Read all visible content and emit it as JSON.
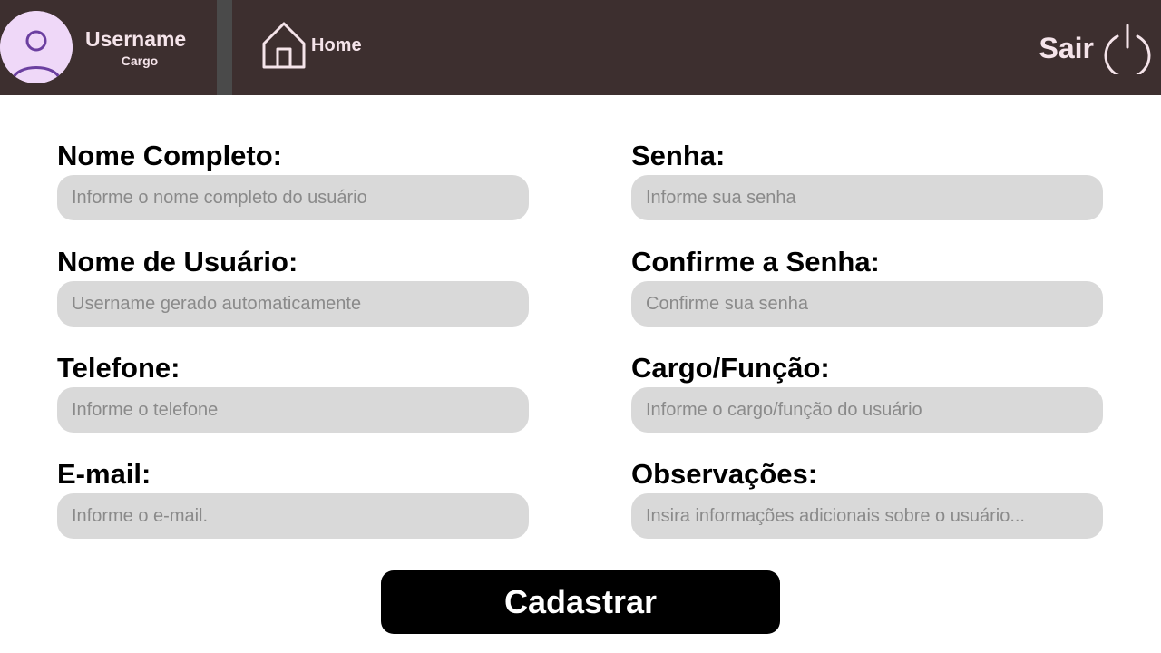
{
  "header": {
    "user_name": "Username",
    "user_role": "Cargo",
    "home_label": "Home",
    "logout_label": "Sair",
    "icons": {
      "avatar": "user-avatar-icon",
      "home": "house-icon",
      "logout": "power-icon"
    },
    "colors": {
      "background": "#3d2f2f",
      "text": "#f5e4ea",
      "avatar_bg": "#efd8f8",
      "avatar_figure": "#6b3fa0",
      "divider": "#4a4a4a"
    }
  },
  "form": {
    "fields": {
      "full_name": {
        "label": "Nome Completo:",
        "placeholder": "Informe o nome completo do usuário",
        "value": ""
      },
      "username": {
        "label": "Nome de Usuário:",
        "placeholder": "Username gerado automaticamente",
        "value": ""
      },
      "phone": {
        "label": "Telefone:",
        "placeholder": "Informe o telefone",
        "value": ""
      },
      "email": {
        "label": "E-mail:",
        "placeholder": "Informe o e-mail.",
        "value": ""
      },
      "password": {
        "label": "Senha:",
        "placeholder": "Informe sua senha",
        "value": ""
      },
      "confirm_password": {
        "label": "Confirme a Senha:",
        "placeholder": "Confirme sua senha",
        "value": ""
      },
      "role": {
        "label": "Cargo/Função:",
        "placeholder": "Informe o cargo/função do usuário",
        "value": ""
      },
      "notes": {
        "label": "Observações:",
        "placeholder": "Insira informações adicionais sobre o usuário...",
        "value": ""
      }
    },
    "submit_label": "Cadastrar",
    "colors": {
      "input_bg": "#d9d9d9",
      "button_bg": "#000000",
      "button_text": "#ffffff"
    }
  }
}
